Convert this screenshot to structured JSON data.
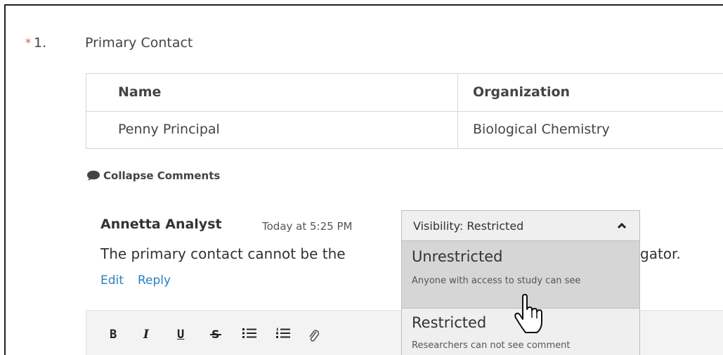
{
  "question": {
    "required_marker": "*",
    "number": "1.",
    "title": "Primary Contact"
  },
  "contact_table": {
    "headers": [
      "Name",
      "Organization"
    ],
    "rows": [
      [
        "Penny Principal",
        "Biological Chemistry"
      ]
    ]
  },
  "comments": {
    "collapse_label": "Collapse Comments",
    "items": [
      {
        "author": "Annetta Analyst",
        "timestamp": "Today at 5:25 PM",
        "text_visible": "The primary contact cannot be the",
        "text_tail": "gator.",
        "actions": {
          "edit": "Edit",
          "reply": "Reply"
        }
      }
    ]
  },
  "visibility": {
    "selected_label": "Visibility: Restricted",
    "options": [
      {
        "title": "Unrestricted",
        "description": "Anyone with access to study can see"
      },
      {
        "title": "Restricted",
        "description": "Researchers can not see comment"
      }
    ]
  },
  "editor_toolbar": {
    "bold": "B",
    "italic": "I",
    "underline": "U",
    "strike": "S"
  },
  "colors": {
    "required": "#d9534f",
    "link": "#2a7fc1",
    "highlight_option": "#d6d6d6"
  }
}
